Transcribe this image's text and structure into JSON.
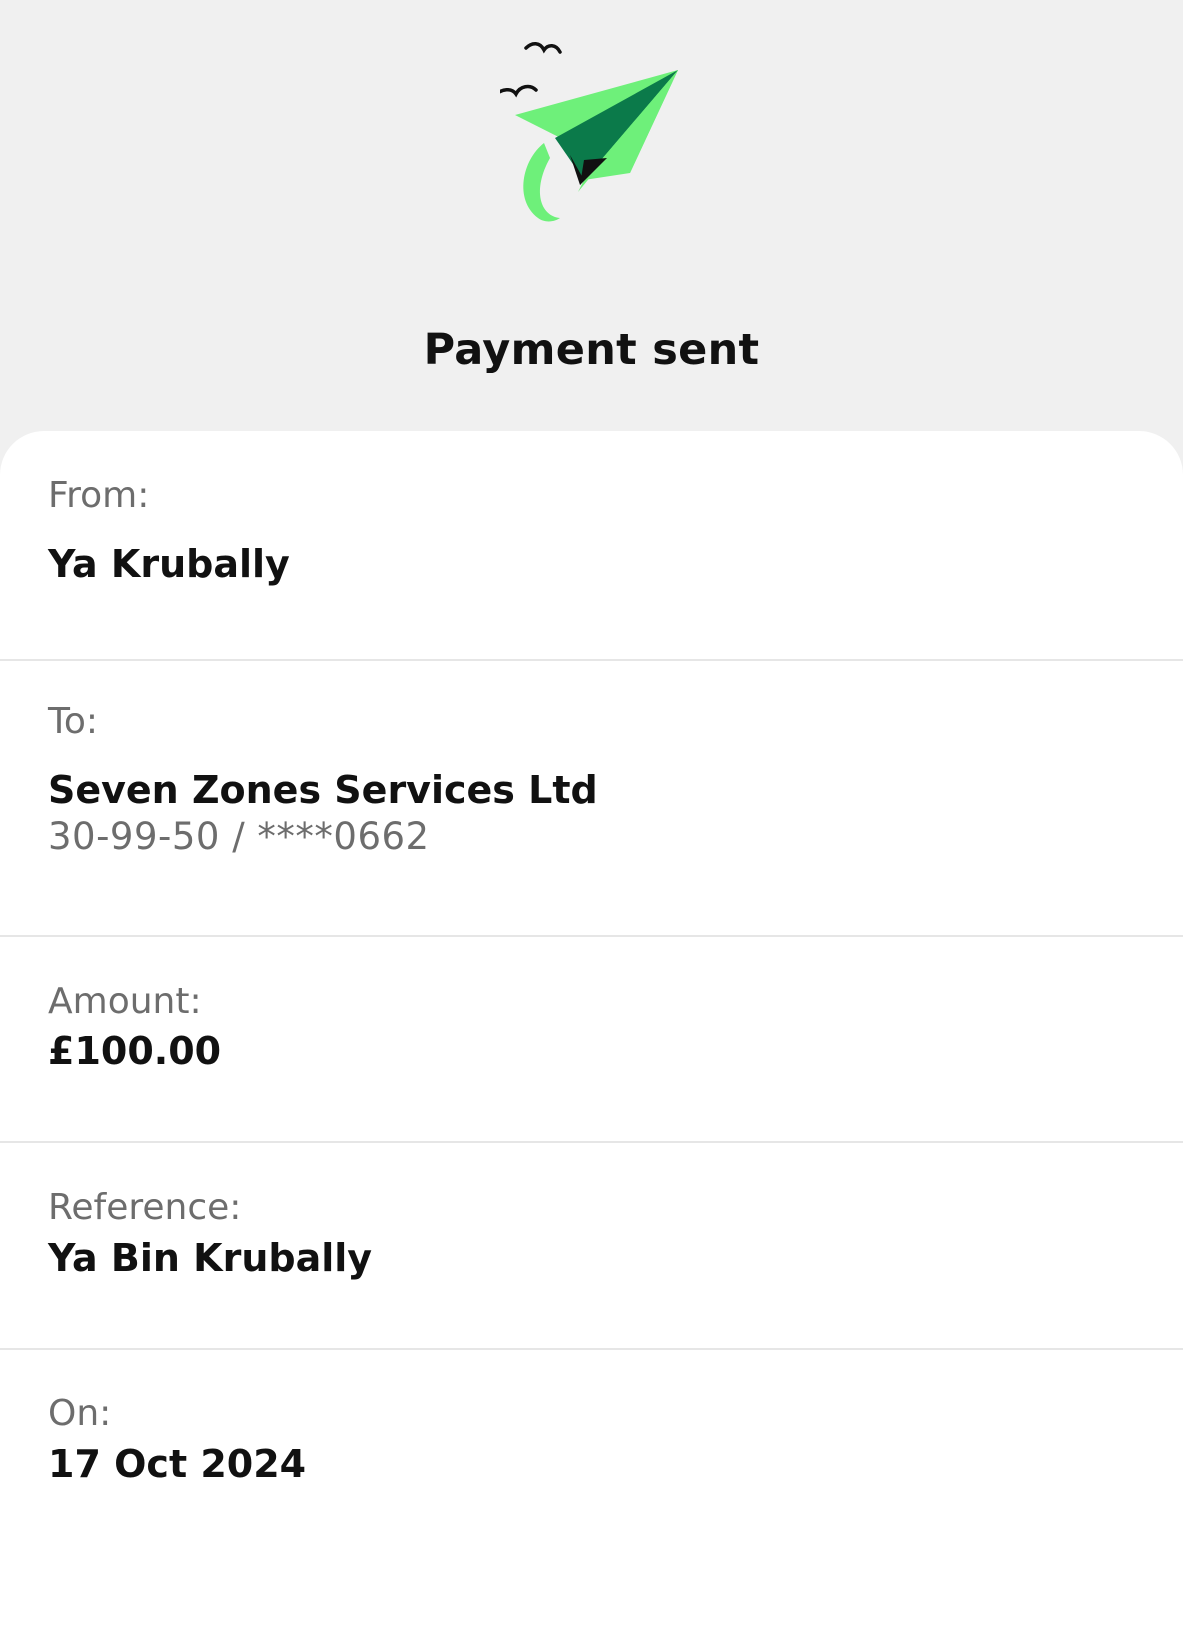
{
  "header": {
    "title": "Payment sent",
    "icon": "paper-plane-icon",
    "accent_light": "#6ef07a",
    "accent_dark": "#0b7a4a"
  },
  "details": {
    "from": {
      "label": "From:",
      "value": "Ya Krubally"
    },
    "to": {
      "label": "To:",
      "value": "Seven Zones Services Ltd",
      "account": "30-99-50 / ****0662"
    },
    "amount": {
      "label": "Amount:",
      "value": "£100.00"
    },
    "reference": {
      "label": "Reference:",
      "value": "Ya Bin Krubally"
    },
    "on": {
      "label": "On:",
      "value": "17 Oct 2024"
    }
  }
}
